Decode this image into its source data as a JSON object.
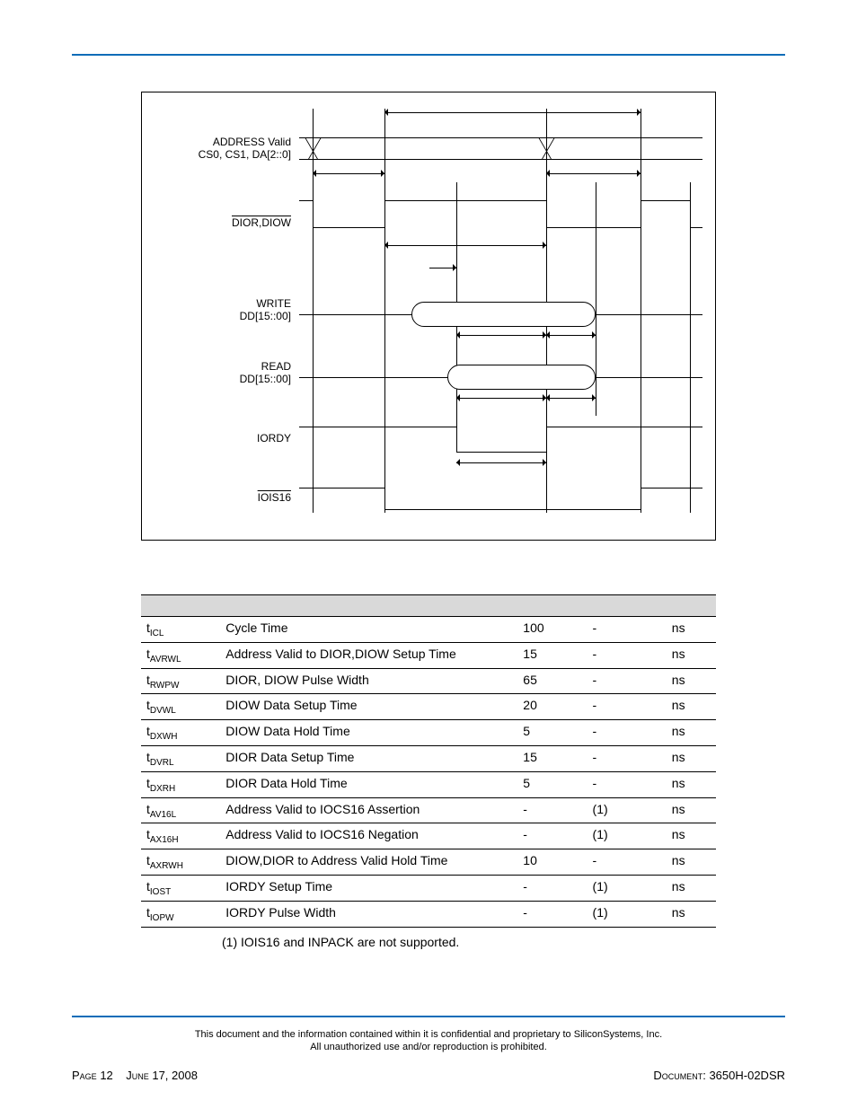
{
  "diagram": {
    "labels": {
      "addr1": "ADDRESS Valid",
      "addr2": "CS0, CS1, DA[2::0]",
      "dior_diow": "DIOR,DIOW",
      "write1": "WRITE",
      "write2": "DD[15::00]",
      "read1": "READ",
      "read2": "DD[15::00]",
      "iordy": "IORDY",
      "iois16": "IOIS16"
    }
  },
  "table": {
    "rows": [
      {
        "sym_main": "t",
        "sym_sub": "ICL",
        "desc": "Cycle Time",
        "min": "100",
        "max": "-",
        "unit": "ns"
      },
      {
        "sym_main": "t",
        "sym_sub": "AVRWL",
        "desc": "Address Valid to DIOR,DIOW Setup Time",
        "min": "15",
        "max": "-",
        "unit": "ns"
      },
      {
        "sym_main": "t",
        "sym_sub": "RWPW",
        "desc": "DIOR, DIOW Pulse Width",
        "min": "65",
        "max": "-",
        "unit": "ns"
      },
      {
        "sym_main": "t",
        "sym_sub": "DVWL",
        "desc": "DIOW Data Setup Time",
        "min": "20",
        "max": "-",
        "unit": "ns"
      },
      {
        "sym_main": "t",
        "sym_sub": "DXWH",
        "desc": "DIOW Data Hold Time",
        "min": "5",
        "max": "-",
        "unit": "ns"
      },
      {
        "sym_main": "t",
        "sym_sub": "DVRL",
        "desc": "DIOR Data Setup Time",
        "min": "15",
        "max": "-",
        "unit": "ns"
      },
      {
        "sym_main": "t",
        "sym_sub": "DXRH",
        "desc": "DIOR Data Hold Time",
        "min": "5",
        "max": "-",
        "unit": "ns"
      },
      {
        "sym_main": "t",
        "sym_sub": "AV16L",
        "desc": "Address Valid to IOCS16 Assertion",
        "min": "-",
        "max": "(1)",
        "unit": "ns"
      },
      {
        "sym_main": "t",
        "sym_sub": "AX16H",
        "desc": "Address Valid to IOCS16 Negation",
        "min": "-",
        "max": "(1)",
        "unit": "ns"
      },
      {
        "sym_main": "t",
        "sym_sub": "AXRWH",
        "desc": "DIOW,DIOR to Address Valid Hold Time",
        "min": "10",
        "max": "-",
        "unit": "ns"
      },
      {
        "sym_main": "t",
        "sym_sub": "IOST",
        "desc": "IORDY Setup Time",
        "min": "-",
        "max": "(1)",
        "unit": "ns"
      },
      {
        "sym_main": "t",
        "sym_sub": "IOPW",
        "desc": "IORDY Pulse Width",
        "min": "-",
        "max": "(1)",
        "unit": "ns"
      }
    ]
  },
  "footnote": "(1) IOIS16 and INPACK are not supported.",
  "confidential_line1": "This document and the information contained within it is confidential and proprietary to SiliconSystems, Inc.",
  "confidential_line2": "All unauthorized use and/or reproduction is prohibited.",
  "footer": {
    "page_label": "Page",
    "page_num": "12",
    "date": "June 17, 2008",
    "doc_label": "Document:",
    "doc_num": "3650H-02DSR"
  }
}
